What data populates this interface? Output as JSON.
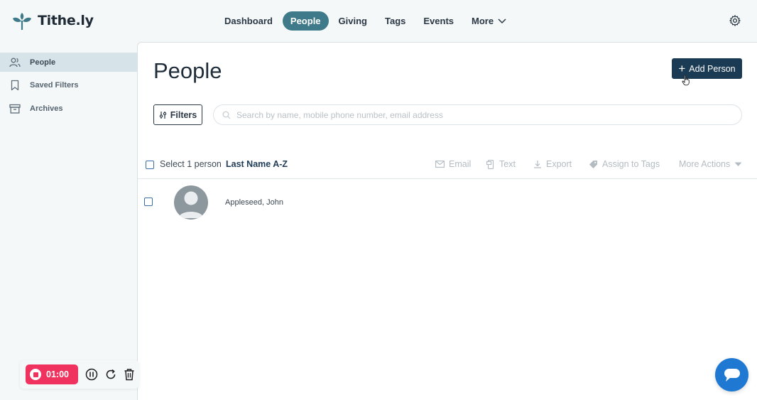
{
  "brand": {
    "name": "Tithe.ly",
    "accent": "#3e7a89",
    "primary_button": "#1b3a53"
  },
  "nav": {
    "items": [
      {
        "label": "Dashboard",
        "active": false
      },
      {
        "label": "People",
        "active": true
      },
      {
        "label": "Giving",
        "active": false
      },
      {
        "label": "Tags",
        "active": false
      },
      {
        "label": "Events",
        "active": false
      },
      {
        "label": "More",
        "active": false
      }
    ],
    "settings_icon": "gear-icon"
  },
  "sidebar": {
    "items": [
      {
        "label": "People",
        "icon": "people-icon",
        "active": true
      },
      {
        "label": "Saved Filters",
        "icon": "bookmark-icon",
        "active": false
      },
      {
        "label": "Archives",
        "icon": "archive-icon",
        "active": false
      }
    ]
  },
  "main": {
    "title": "People",
    "add_button": "Add Person",
    "filters_button": "Filters",
    "search_placeholder": "Search by name, mobile phone number, email address",
    "toolbar": {
      "select_label": "Select 1 person",
      "sort_label": "Last Name A-Z",
      "actions": [
        "Email",
        "Text",
        "Export",
        "Assign to Tags",
        "More Actions"
      ]
    },
    "people": [
      {
        "name": "Appleseed, John"
      }
    ]
  },
  "recorder": {
    "time": "01:00",
    "color": "#f0325e"
  },
  "chat": {
    "icon": "chat-icon",
    "color": "#1f78d1"
  }
}
